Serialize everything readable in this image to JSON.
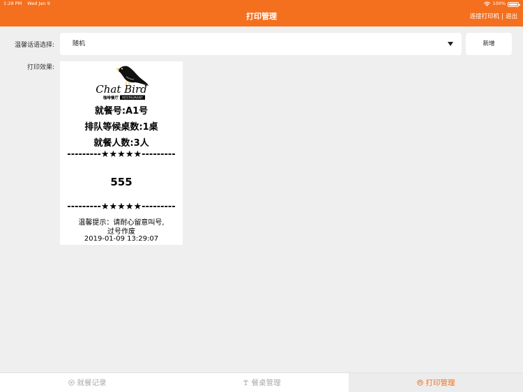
{
  "status_bar": {
    "time": "1:29 PM",
    "date": "Wed Jan 9",
    "battery": "100%"
  },
  "nav": {
    "title": "打印管理",
    "connect_printer": "连接打印机",
    "separator": "|",
    "logout": "退出"
  },
  "form": {
    "greeting_label": "温馨话语选择:",
    "greeting_value": "随机",
    "add_button": "新增",
    "preview_label": "打印效果:"
  },
  "receipt": {
    "logo_text": "Chat Bird",
    "logo_subtext": "咖啡餐厅",
    "logo_badge": "RESTAURANT",
    "dining_number": "就餐号:A1号",
    "queue_tables": "排队等候桌数:1桌",
    "diners": "就餐人数:3人",
    "stars_top": "---------★★★★★---------",
    "message": "555",
    "stars_bottom": "---------★★★★★---------",
    "tip_line1": "温馨提示：请耐心留意叫号,",
    "tip_line2": "过号作废",
    "timestamp": "2019-01-09 13:29:07"
  },
  "tabs": [
    {
      "label": "就餐记录",
      "icon": "list-icon",
      "active": false
    },
    {
      "label": "餐桌管理",
      "icon": "table-icon",
      "active": false
    },
    {
      "label": "打印管理",
      "icon": "printer-icon",
      "active": true
    }
  ],
  "colors": {
    "accent": "#f4701f",
    "background": "#efefef",
    "active_tab_bg": "#ececec"
  }
}
